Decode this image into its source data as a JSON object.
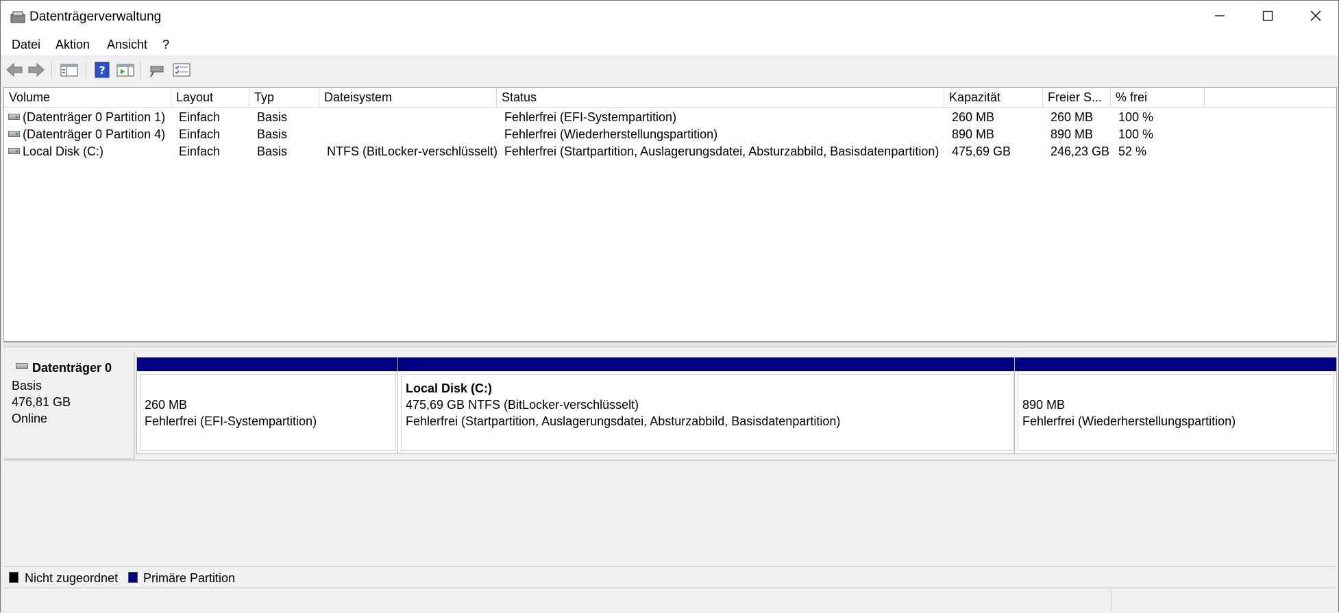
{
  "window": {
    "title": "Datenträgerverwaltung",
    "icons": {
      "app": "disk-management-icon",
      "minimize": "minimize-icon",
      "maximize": "maximize-icon",
      "close": "close-icon"
    }
  },
  "menu": [
    "Datei",
    "Aktion",
    "Ansicht",
    "?"
  ],
  "toolbar": [
    "back-arrow-icon",
    "forward-arrow-icon",
    "console-tree-icon",
    "help-icon",
    "action-pane-icon",
    "connect-disk-icon",
    "properties-icon"
  ],
  "volume_list": {
    "headers": [
      "Volume",
      "Layout",
      "Typ",
      "Dateisystem",
      "Status",
      "Kapazität",
      "Freier S...",
      "% frei"
    ],
    "rows": [
      [
        "(Datenträger 0 Partition 1)",
        "Einfach",
        "Basis",
        "",
        "Fehlerfrei (EFI-Systempartition)",
        "260 MB",
        "260 MB",
        "100 %"
      ],
      [
        "(Datenträger 0 Partition 4)",
        "Einfach",
        "Basis",
        "",
        "Fehlerfrei (Wiederherstellungspartition)",
        "890 MB",
        "890 MB",
        "100 %"
      ],
      [
        "Local Disk (C:)",
        "Einfach",
        "Basis",
        "NTFS (BitLocker-verschlüsselt)",
        "Fehlerfrei (Startpartition, Auslagerungsdatei, Absturzabbild, Basisdatenpartition)",
        "475,69 GB",
        "246,23 GB",
        "52 %"
      ]
    ]
  },
  "disk": {
    "name": "Datenträger 0",
    "type": "Basis",
    "size": "476,81 GB",
    "state": "Online",
    "partitions": [
      {
        "name": "",
        "line1": "260 MB",
        "line2": "Fehlerfrei (EFI-Systempartition)"
      },
      {
        "name": "Local Disk  (C:)",
        "line1": "475,69 GB NTFS (BitLocker-verschlüsselt)",
        "line2": "Fehlerfrei (Startpartition, Auslagerungsdatei, Absturzabbild, Basisdatenpartition)"
      },
      {
        "name": "",
        "line1": "890 MB",
        "line2": "Fehlerfrei (Wiederherstellungspartition)"
      }
    ]
  },
  "legend": [
    {
      "label": "Nicht zugeordnet",
      "color": "#000000"
    },
    {
      "label": "Primäre Partition",
      "color": "#000080"
    }
  ]
}
